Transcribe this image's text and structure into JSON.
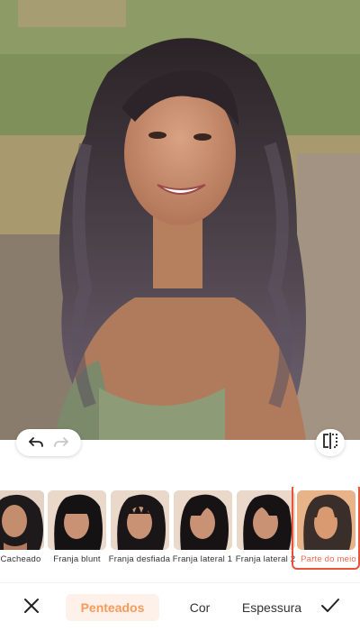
{
  "colors": {
    "accent": "#f59b5b",
    "selected_border": "#e8513a",
    "active_label": "#f26b4c",
    "tab_active_bg": "#fdf1ea"
  },
  "toolbar": {
    "undo_icon": "undo-icon",
    "redo_icon": "redo-icon",
    "compare_icon": "compare-icon"
  },
  "styles": [
    {
      "label": "Cacheado",
      "hair": "curly"
    },
    {
      "label": "Franja blunt",
      "hair": "blunt"
    },
    {
      "label": "Franja desfiada",
      "hair": "wispy"
    },
    {
      "label": "Franja lateral 1",
      "hair": "side1"
    },
    {
      "label": "Franja lateral 2",
      "hair": "side2"
    },
    {
      "label": "Parte do meio",
      "hair": "middle",
      "selected": true
    }
  ],
  "tabs": [
    {
      "label": "Penteados",
      "active": true
    },
    {
      "label": "Cor",
      "active": false
    },
    {
      "label": "Espessura",
      "active": false
    }
  ],
  "actions": {
    "close_icon": "close-icon",
    "confirm_icon": "checkmark-icon"
  }
}
